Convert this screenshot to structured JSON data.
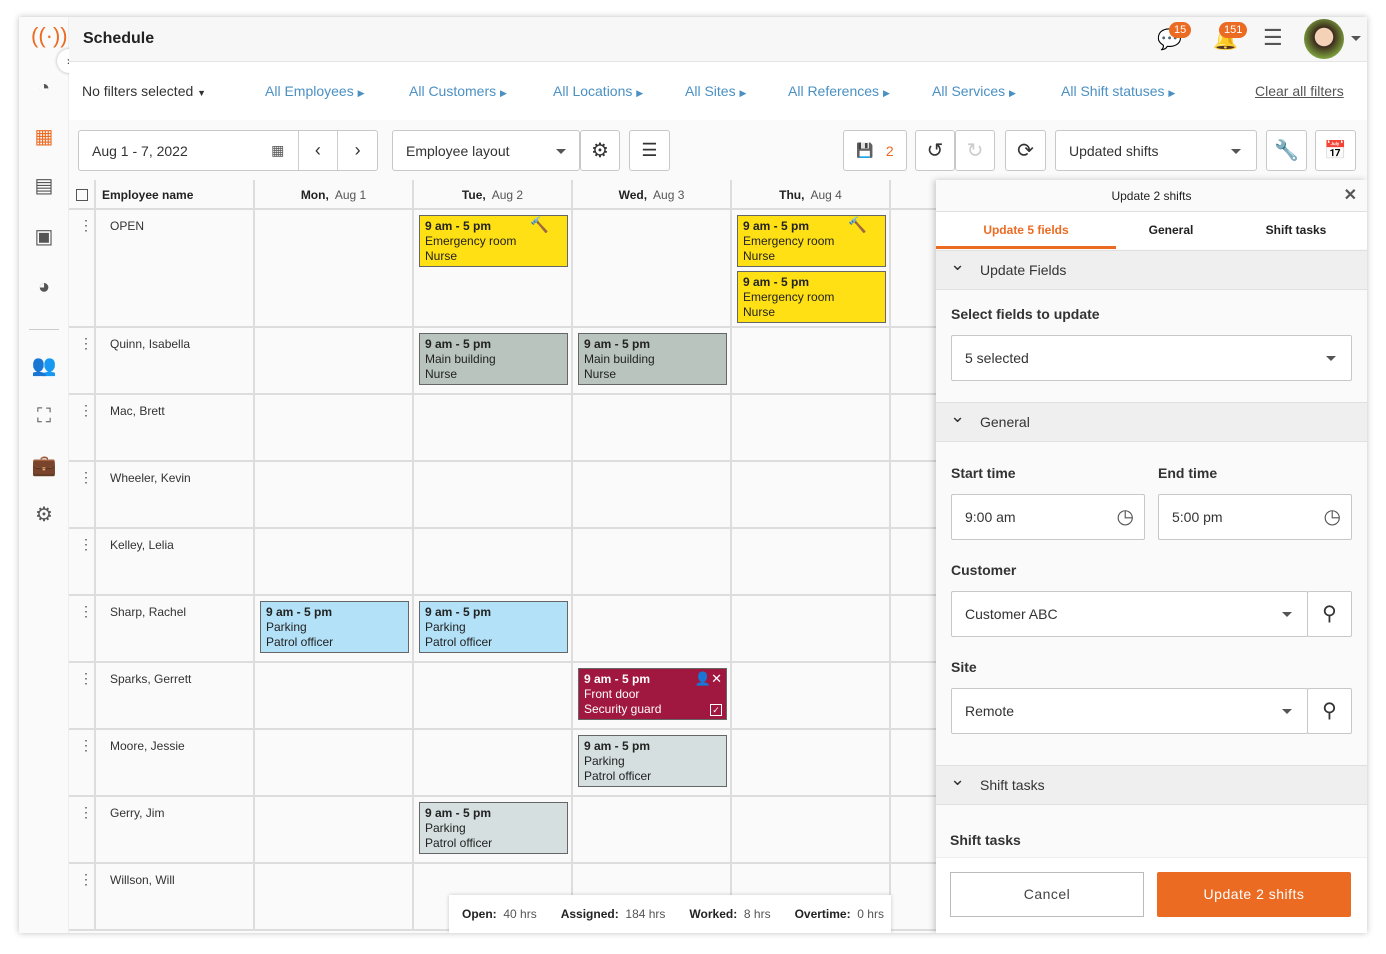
{
  "header": {
    "title": "Schedule",
    "chat_count": "15",
    "notif_count": "151"
  },
  "filters": {
    "preset": "No filters selected",
    "links": [
      "All Employees",
      "All Customers",
      "All Locations",
      "All Sites",
      "All References",
      "All Services",
      "All Shift statuses"
    ],
    "clear": "Clear all filters"
  },
  "toolbar": {
    "date_range": "Aug 1 - 7, 2022",
    "layout": "Employee layout",
    "save_count": "2",
    "view": "Updated shifts"
  },
  "grid": {
    "name_header": "Employee name",
    "days": [
      {
        "d": "Mon,",
        "date": "Aug 1"
      },
      {
        "d": "Tue,",
        "date": "Aug 2"
      },
      {
        "d": "Wed,",
        "date": "Aug 3"
      },
      {
        "d": "Thu,",
        "date": "Aug 4"
      }
    ],
    "employees": [
      "OPEN",
      "Quinn, Isabella",
      "Mac, Brett",
      "Wheeler, Kevin",
      "Kelley, Lelia",
      "Sharp, Rachel",
      "Sparks, Gerrett",
      "Moore, Jessie",
      "Gerry, Jim",
      "Willson, Will"
    ],
    "shifts": [
      {
        "row": 0,
        "day": 1,
        "slot": 0,
        "time": "9 am - 5 pm",
        "loc": "Emergency room",
        "role": "Nurse",
        "color": "#ffe014",
        "icon": "gavel"
      },
      {
        "row": 0,
        "day": 3,
        "slot": 0,
        "time": "9 am - 5 pm",
        "loc": "Emergency room",
        "role": "Nurse",
        "color": "#ffe014",
        "icon": "gavel-plus"
      },
      {
        "row": 0,
        "day": 3,
        "slot": 1,
        "time": "9 am - 5 pm",
        "loc": "Emergency room",
        "role": "Nurse",
        "color": "#ffe014"
      },
      {
        "row": 1,
        "day": 1,
        "slot": 0,
        "time": "9 am - 5 pm",
        "loc": "Main building",
        "role": "Nurse",
        "color": "#b8c4bd"
      },
      {
        "row": 1,
        "day": 2,
        "slot": 0,
        "time": "9 am - 5 pm",
        "loc": "Main building",
        "role": "Nurse",
        "color": "#b8c4bd"
      },
      {
        "row": 5,
        "day": 0,
        "slot": 0,
        "time": "9 am - 5 pm",
        "loc": "Parking",
        "role": "Patrol officer",
        "color": "#b3e1f7"
      },
      {
        "row": 5,
        "day": 1,
        "slot": 0,
        "time": "9 am - 5 pm",
        "loc": "Parking",
        "role": "Patrol officer",
        "color": "#b3e1f7"
      },
      {
        "row": 6,
        "day": 2,
        "slot": 0,
        "time": "9 am - 5 pm",
        "loc": "Front door",
        "role": "Security guard",
        "color": "#a0173f",
        "icon": "user-remove"
      },
      {
        "row": 7,
        "day": 2,
        "slot": 0,
        "time": "9 am - 5 pm",
        "loc": "Parking",
        "role": "Patrol officer",
        "color": "#d5dfe0"
      },
      {
        "row": 8,
        "day": 1,
        "slot": 0,
        "time": "9 am - 5 pm",
        "loc": "Parking",
        "role": "Patrol officer",
        "color": "#d5dfe0"
      }
    ]
  },
  "totals": [
    {
      "k": "Open:",
      "v": "40 hrs"
    },
    {
      "k": "Assigned:",
      "v": "184 hrs"
    },
    {
      "k": "Worked:",
      "v": "8 hrs"
    },
    {
      "k": "Overtime:",
      "v": "0 hrs"
    }
  ],
  "panel": {
    "title": "Update 2 shifts",
    "tabs": [
      "Update 5 fields",
      "General",
      "Shift tasks"
    ],
    "sec_update": "Update Fields",
    "select_label": "Select fields to update",
    "select_value": "5 selected",
    "sec_general": "General",
    "start_label": "Start time",
    "start": "9:00 am",
    "end_label": "End time",
    "end": "5:00 pm",
    "customer_label": "Customer",
    "customer": "Customer ABC",
    "site_label": "Site",
    "site": "Remote",
    "sec_tasks": "Shift tasks",
    "tasks_label": "Shift tasks",
    "cancel": "Cancel",
    "submit": "Update 2 shifts"
  },
  "colors": {
    "accent": "#ec6b23",
    "link": "#4a90c2"
  }
}
